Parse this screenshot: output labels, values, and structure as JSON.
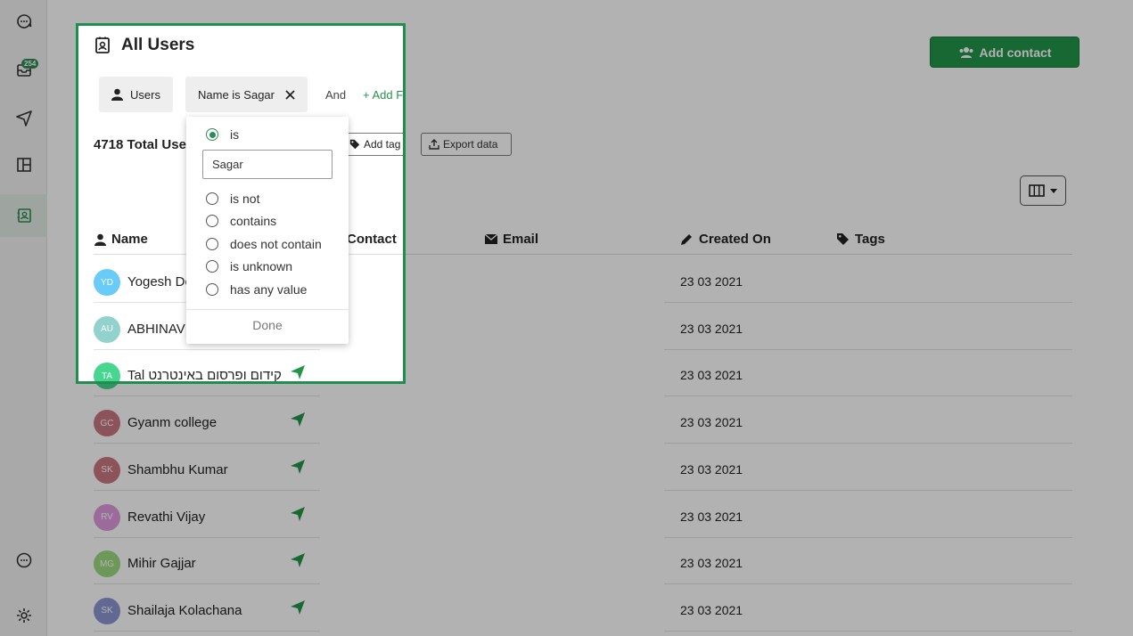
{
  "sidebar": {
    "inbox_badge": "254",
    "icons": [
      "chat-logo-icon",
      "inbox-icon",
      "send-icon",
      "layout-icon",
      "contacts-icon",
      "support-chat-icon",
      "settings-icon"
    ]
  },
  "header": {
    "title": "All Users",
    "add_contact_label": "Add contact"
  },
  "filters": {
    "users_chip": "Users",
    "name_chip": "Name is Sagar",
    "and_label": "And",
    "add_filter_label": "+ Add Filter"
  },
  "toolbar": {
    "total_users": "4718 Total Users",
    "add_tag_label": "Add tag",
    "export_label": "Export data"
  },
  "table": {
    "columns": {
      "name": "Name",
      "contact": "Contact",
      "email": "Email",
      "created_on": "Created On",
      "tags": "Tags"
    },
    "rows": [
      {
        "initials": "YD",
        "name": "Yogesh Dodiya",
        "created": "23 03 2021",
        "color": "#4fc3f7"
      },
      {
        "initials": "AU",
        "name": "ABHINAV UPADHYAY",
        "created": "23 03 2021",
        "color": "#80cbc4"
      },
      {
        "initials": "TA",
        "name": "Tal קידום ופרסום באינטרנט",
        "created": "23 03 2021",
        "color": "#26d07c"
      },
      {
        "initials": "GC",
        "name": "Gyanm college",
        "created": "23 03 2021",
        "color": "#c2606e"
      },
      {
        "initials": "SK",
        "name": "Shambhu Kumar",
        "created": "23 03 2021",
        "color": "#c2606e"
      },
      {
        "initials": "RV",
        "name": "Revathi Vijay",
        "created": "23 03 2021",
        "color": "#d98ad9"
      },
      {
        "initials": "MG",
        "name": "Mihir Gajjar",
        "created": "23 03 2021",
        "color": "#8bd46b"
      },
      {
        "initials": "SK",
        "name": "Shailaja Kolachana",
        "created": "23 03 2021",
        "color": "#7986cb"
      }
    ]
  },
  "filter_dropdown": {
    "options": [
      "is",
      "is not",
      "contains",
      "does not contain",
      "is unknown",
      "has any value"
    ],
    "selected": "is",
    "input_value": "Sagar",
    "done_label": "Done"
  },
  "colors": {
    "accent": "#23954a",
    "highlight_border": "#1f8f50"
  }
}
